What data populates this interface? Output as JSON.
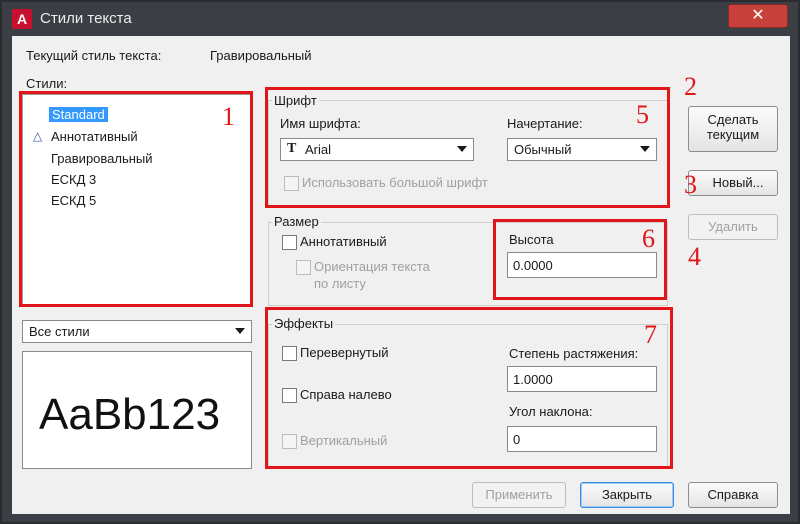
{
  "window": {
    "title": "Стили текста",
    "app_icon": "A",
    "close_symbol": "✕"
  },
  "current_style": {
    "label": "Текущий стиль текста:",
    "value": "Гравировальный"
  },
  "styles": {
    "label": "Стили:",
    "items": [
      {
        "label": "Standard",
        "selected": true,
        "annotative": false
      },
      {
        "label": "Аннотативный",
        "selected": false,
        "annotative": true
      },
      {
        "label": "Гравировальный",
        "selected": false,
        "annotative": false
      },
      {
        "label": "ЕСКД 3",
        "selected": false,
        "annotative": false
      },
      {
        "label": "ЕСКД 5",
        "selected": false,
        "annotative": false
      }
    ],
    "filter_value": "Все стили",
    "preview_text": "AaBb123"
  },
  "font": {
    "group_label": "Шрифт",
    "name_label": "Имя шрифта:",
    "name_value": "Arial",
    "style_label": "Начертание:",
    "style_value": "Обычный",
    "bigfont_label": "Использовать большой шрифт"
  },
  "size": {
    "group_label": "Размер",
    "annotative_label": "Аннотативный",
    "orientation_label_1": "Ориентация текста",
    "orientation_label_2": "по листу",
    "height_label": "Высота",
    "height_value": "0.0000"
  },
  "effects": {
    "group_label": "Эффекты",
    "upside_down_label": "Перевернутый",
    "backwards_label": "Справа налево",
    "vertical_label": "Вертикальный",
    "width_factor_label": "Степень растяжения:",
    "width_factor_value": "1.0000",
    "oblique_label": "Угол наклона:",
    "oblique_value": "0"
  },
  "buttons": {
    "set_current": [
      "Сделать",
      "текущим"
    ],
    "new": "Новый...",
    "delete": "Удалить",
    "apply": "Применить",
    "close": "Закрыть",
    "help": "Справка"
  },
  "annotations": [
    "1",
    "2",
    "3",
    "4",
    "5",
    "6",
    "7"
  ],
  "colors": {
    "annotation_red": "#e0161b",
    "selection_blue": "#3399ff",
    "title_bar": "#3b3e44"
  }
}
